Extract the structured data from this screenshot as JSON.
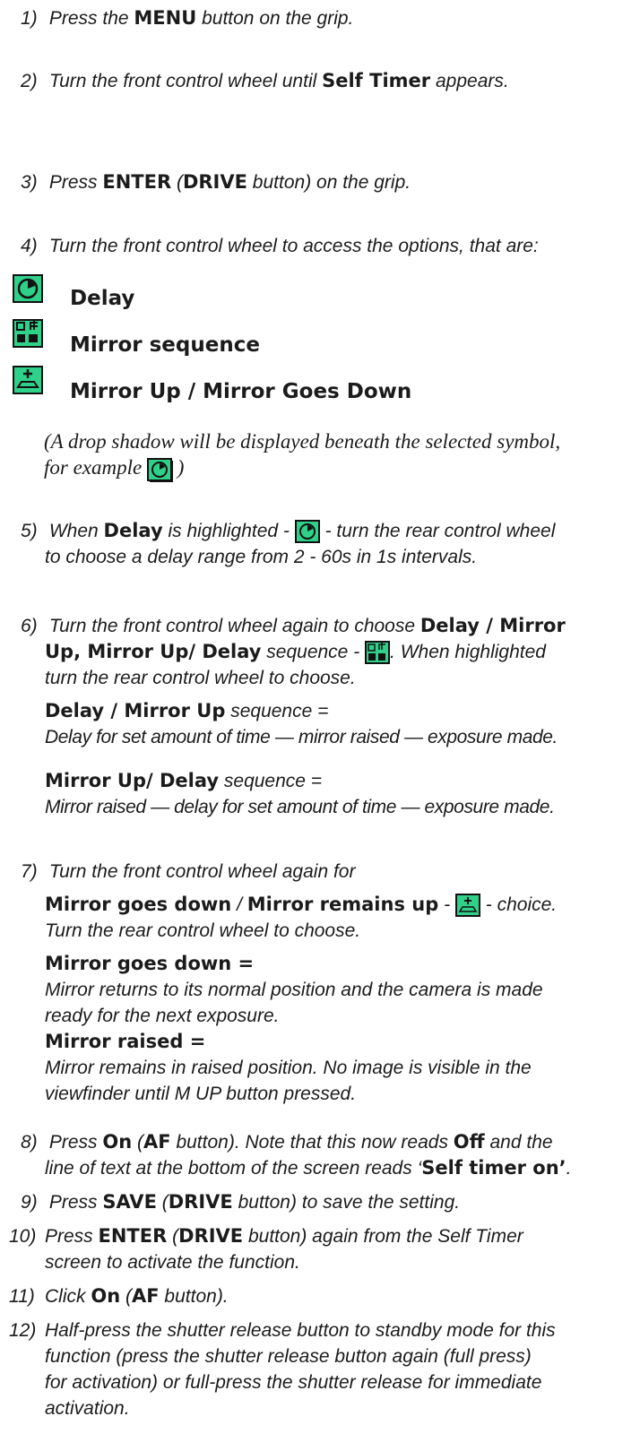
{
  "steps": {
    "s1": {
      "num": "1)",
      "a": "Press the ",
      "b": "MENU",
      "c": " button on the grip."
    },
    "s2": {
      "num": "2)",
      "a": "Turn the front control wheel until ",
      "b": "Self Timer",
      "c": " appears."
    },
    "s3": {
      "num": "3)",
      "a": "Press ",
      "b": "ENTER",
      "c": " (",
      "d": "DRIVE",
      "e": " button) on the grip."
    },
    "s4": {
      "num": "4)",
      "a": "Turn the front control wheel to access the options, that are:"
    },
    "options": [
      "Delay",
      "Mirror sequence",
      "Mirror Up / Mirror Goes Down"
    ],
    "note": {
      "a": "(A drop shadow will be displayed beneath the selected symbol,",
      "b": "for example ",
      "c": " )"
    },
    "s5": {
      "num": "5)",
      "a": "When ",
      "b": "Delay",
      "c": " is highlighted - ",
      "d": " - turn the rear control wheel",
      "e": "to choose a delay range from 2 - 60s in 1s intervals."
    },
    "s6": {
      "num": "6)",
      "a": "Turn the front control wheel again to choose ",
      "b": "Delay / Mirror",
      "c": "Up",
      "d": ", ",
      "e": "Mirror Up/ Delay",
      "f": " sequence - ",
      "g": ". When highlighted",
      "h": "turn the rear control wheel to choose.",
      "seq1_title": "Delay / Mirror Up",
      "seq1_suffix": " sequence =",
      "seq1_desc": "Delay for set amount of time — mirror raised — exposure made.",
      "seq2_title": "Mirror Up/ Delay",
      "seq2_suffix": " sequence =",
      "seq2_desc": "Mirror raised — delay for set amount of time — exposure made."
    },
    "s7": {
      "num": "7)",
      "a": "Turn the front control wheel again for",
      "b": "Mirror goes down",
      "c": " / ",
      "d": "Mirror remains up",
      "e": " - ",
      "f": " - choice.",
      "g": "Turn the rear control wheel to choose.",
      "down_title": "Mirror goes down =",
      "down_desc1": "Mirror returns to its normal position and the camera is made",
      "down_desc2": "ready for the next exposure.",
      "raised_title": "Mirror raised =",
      "raised_desc1": "Mirror remains in raised position. No image is visible in the",
      "raised_desc2": "viewfinder until M UP button pressed."
    },
    "s8": {
      "num": "8)",
      "a": "Press ",
      "b": "On",
      "c": " (",
      "d": "AF",
      "e": " button). Note that this now reads ",
      "f": "Off",
      "g": " and the",
      "h": "line of text at the bottom of the screen reads ‘",
      "i": "Self timer on’",
      "j": "."
    },
    "s9": {
      "num": "9)",
      "a": "Press ",
      "b": "SAVE",
      "c": " (",
      "d": "DRIVE",
      "e": " button) to save the setting."
    },
    "s10": {
      "num": "10)",
      "a": "Press ",
      "b": "ENTER",
      "c": " (",
      "d": "DRIVE",
      "e": " button) again from the Self Timer",
      "f": "screen to activate the function."
    },
    "s11": {
      "num": "11)",
      "a": "Click ",
      "b": "On",
      "c": " (",
      "d": "AF",
      "e": " button)."
    },
    "s12": {
      "num": "12)",
      "l1": "Half-press the shutter release button to standby mode for this",
      "l2": "function (press the shutter release button again (full press)",
      "l3": "for activation) or full-press the shutter release for immediate",
      "l4": "activation."
    }
  },
  "icons": [
    "delay-icon",
    "mirror-sequence-icon",
    "mirror-up-icon"
  ],
  "colors": {
    "icon_bg": "#2fd18a",
    "text": "#1b1b1b"
  }
}
